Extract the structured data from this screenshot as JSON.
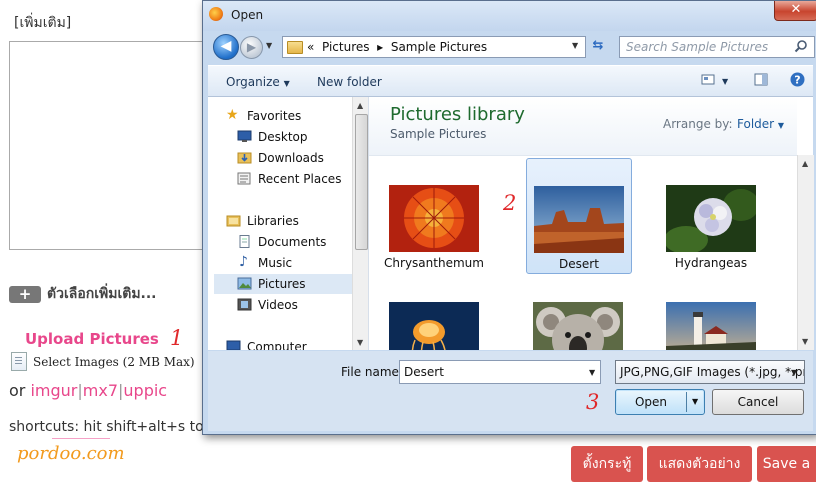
{
  "page": {
    "more_link": "[เพิ่มเติม]",
    "options_plus": "+",
    "options_label": "ตัวเลือกเพิ่มเติม...",
    "upload_title": "Upload Pictures",
    "select_images": "Select Images (2 MB Max)",
    "hosts_prefix": "or",
    "hosts": [
      "imgur",
      "mx7",
      "uppic"
    ],
    "host_separator": "|",
    "shortcuts": "shortcuts: hit shift+alt+s to",
    "watermark": "pordoo.com",
    "buttons": [
      "ตั้งกระทู้",
      "แสดงตัวอย่าง",
      "Save a"
    ],
    "button_color": "#d9534f"
  },
  "annotations": [
    "1",
    "2",
    "3"
  ],
  "dialog": {
    "title": "Open",
    "close_glyph": "✕",
    "back_glyph": "◀",
    "forward_glyph": "▶",
    "address": {
      "prefix": "«",
      "path": [
        "Pictures",
        "Sample Pictures"
      ],
      "separator": "▸"
    },
    "search_placeholder": "Search Sample Pictures",
    "toolbar": {
      "organize": "Organize",
      "new_folder": "New folder"
    },
    "nav": {
      "favorites": {
        "header": "Favorites",
        "items": [
          "Desktop",
          "Downloads",
          "Recent Places"
        ]
      },
      "libraries": {
        "header": "Libraries",
        "items": [
          "Documents",
          "Music",
          "Pictures",
          "Videos"
        ]
      },
      "computer": "Computer",
      "selected": "Pictures"
    },
    "library": {
      "title": "Pictures library",
      "subtitle": "Sample Pictures",
      "arrange_label": "Arrange by:",
      "arrange_value": "Folder"
    },
    "files": [
      {
        "name": "Chrysanthemum",
        "icon": "chrysanthemum-thumbnail"
      },
      {
        "name": "Desert",
        "icon": "desert-thumbnail",
        "selected": true
      },
      {
        "name": "Hydrangeas",
        "icon": "hydrangeas-thumbnail"
      },
      {
        "name": "",
        "icon": "jellyfish-thumbnail"
      },
      {
        "name": "",
        "icon": "koala-thumbnail"
      },
      {
        "name": "",
        "icon": "lighthouse-thumbnail"
      }
    ],
    "file_name_label": "File name:",
    "file_name_value": "Desert",
    "file_type": "JPG,PNG,GIF Images (*.jpg, *.pr",
    "open_button": "Open",
    "cancel_button": "Cancel"
  },
  "colors": {
    "accent_pink": "#e8478b",
    "annotation_red": "#e0282a",
    "watermark_orange": "#f29a1d",
    "library_title_green": "#1e6a2e",
    "selection_blue": "#cfe3f8"
  }
}
